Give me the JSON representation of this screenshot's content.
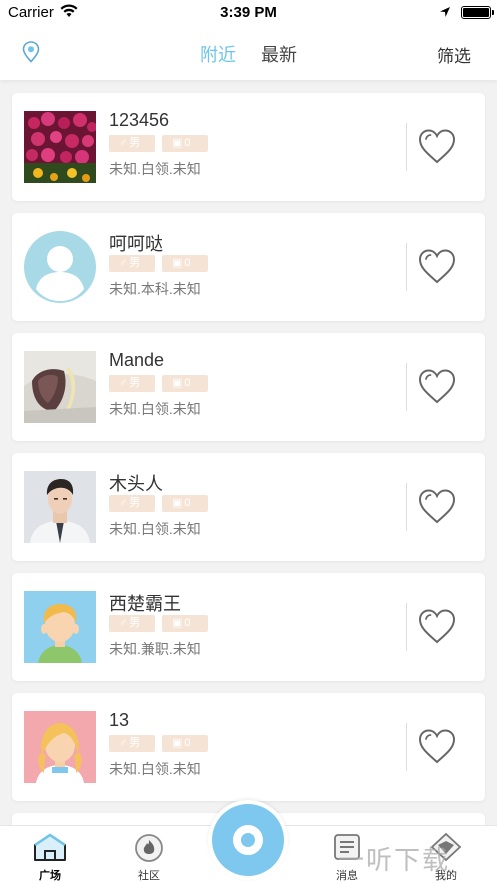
{
  "status_bar": {
    "carrier": "Carrier",
    "time": "3:39 PM",
    "battery_level": 1.0
  },
  "nav": {
    "tabs": [
      {
        "label": "附近",
        "active": true
      },
      {
        "label": "最新",
        "active": false
      }
    ],
    "filter_label": "筛选",
    "accent_color": "#6ec5e9"
  },
  "users": [
    {
      "name": "123456",
      "gender": "男",
      "photo_count": "0",
      "info": "未知.白领.未知",
      "avatar": "flowers"
    },
    {
      "name": "呵呵哒",
      "gender": "男",
      "photo_count": "0",
      "info": "未知.本科.未知",
      "avatar": "default"
    },
    {
      "name": "Mande",
      "gender": "男",
      "photo_count": "0",
      "info": "未知.白领.未知",
      "avatar": "food"
    },
    {
      "name": "木头人",
      "gender": "男",
      "photo_count": "0",
      "info": "未知.白领.未知",
      "avatar": "man"
    },
    {
      "name": "西楚霸王",
      "gender": "男",
      "photo_count": "0",
      "info": "未知.兼职.未知",
      "avatar": "girl-blue"
    },
    {
      "name": "13",
      "gender": "男",
      "photo_count": "0",
      "info": "未知.白领.未知",
      "avatar": "girl-pink"
    }
  ],
  "tab_bar": {
    "items": [
      {
        "label": "广场",
        "icon": "home-icon",
        "active": true
      },
      {
        "label": "社区",
        "icon": "flame-icon",
        "active": false
      },
      {
        "label": "消息",
        "icon": "message-icon",
        "active": false
      },
      {
        "label": "我的",
        "icon": "diamond-icon",
        "active": false
      }
    ],
    "center_icon": "camera-ring-icon"
  },
  "watermark": "一听下载"
}
